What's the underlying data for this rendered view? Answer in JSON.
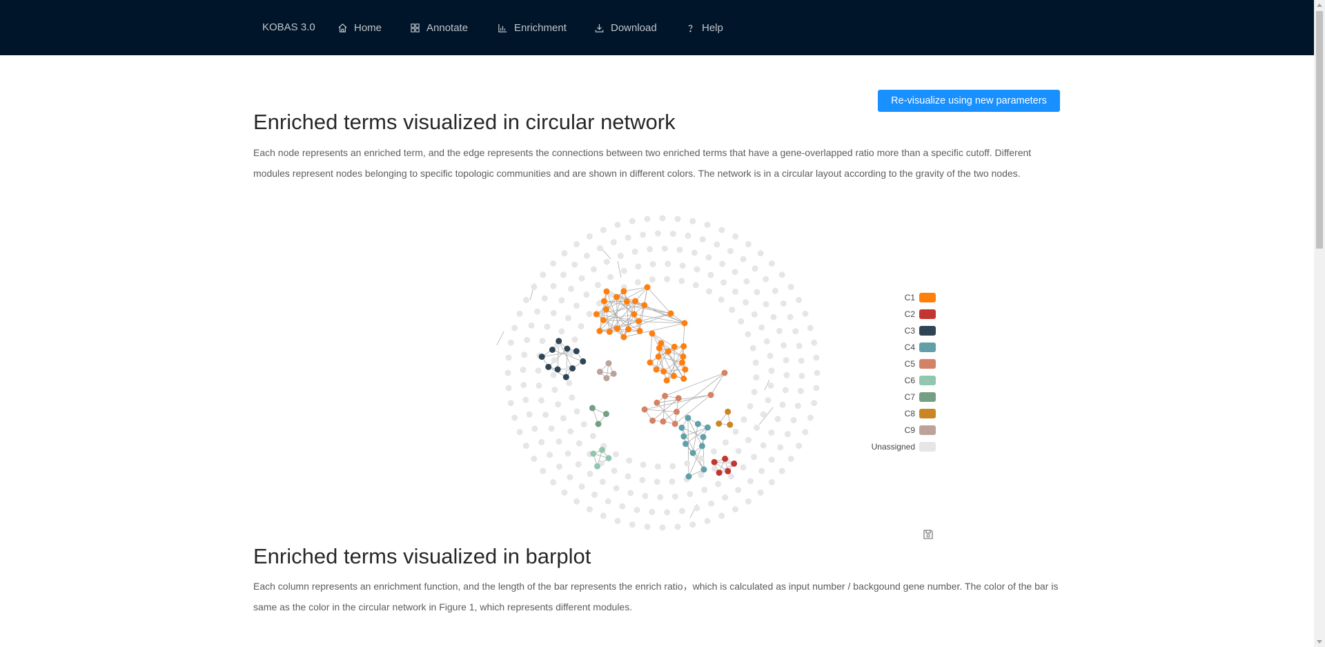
{
  "nav": {
    "brand": "KOBAS 3.0",
    "items": [
      {
        "label": "Home",
        "icon": "home-icon"
      },
      {
        "label": "Annotate",
        "icon": "grid-icon"
      },
      {
        "label": "Enrichment",
        "icon": "bar-chart-icon"
      },
      {
        "label": "Download",
        "icon": "download-icon"
      },
      {
        "label": "Help",
        "icon": "question-icon"
      }
    ]
  },
  "revisualize_button": "Re-visualize using new parameters",
  "network_section": {
    "title": "Enriched terms visualized in circular network",
    "description": "Each node represents an enriched term, and the edge represents the connections between two enriched terms that have a gene-overlapped ratio more than a specific cutoff. Different modules represent nodes belonging to specific topologic communities and are shown in different colors. The network is in a circular layout according to the gravity of the two nodes."
  },
  "legend": [
    {
      "label": "C1",
      "color": "#ff7f0e"
    },
    {
      "label": "C2",
      "color": "#c23531"
    },
    {
      "label": "C3",
      "color": "#2f4554"
    },
    {
      "label": "C4",
      "color": "#61a0a8"
    },
    {
      "label": "C5",
      "color": "#d48265"
    },
    {
      "label": "C6",
      "color": "#91c7ae"
    },
    {
      "label": "C7",
      "color": "#749f83"
    },
    {
      "label": "C8",
      "color": "#ca8622"
    },
    {
      "label": "C9",
      "color": "#bda29a"
    },
    {
      "label": "Unassigned",
      "color": "#e6e6e6"
    }
  ],
  "save_icon": "save-image-icon",
  "barplot_section": {
    "title": "Enriched terms visualized in barplot",
    "description": "Each column represents an enrichment function, and the length of the bar represents the enrich ratio，which is calculated as input number / backgound gene number. The color of the bar is same as the color in the circular network in Figure 1, which represents different modules."
  },
  "colors": {
    "nav_bg": "#001529",
    "primary": "#1890ff",
    "edge": "#aaaaaa"
  }
}
